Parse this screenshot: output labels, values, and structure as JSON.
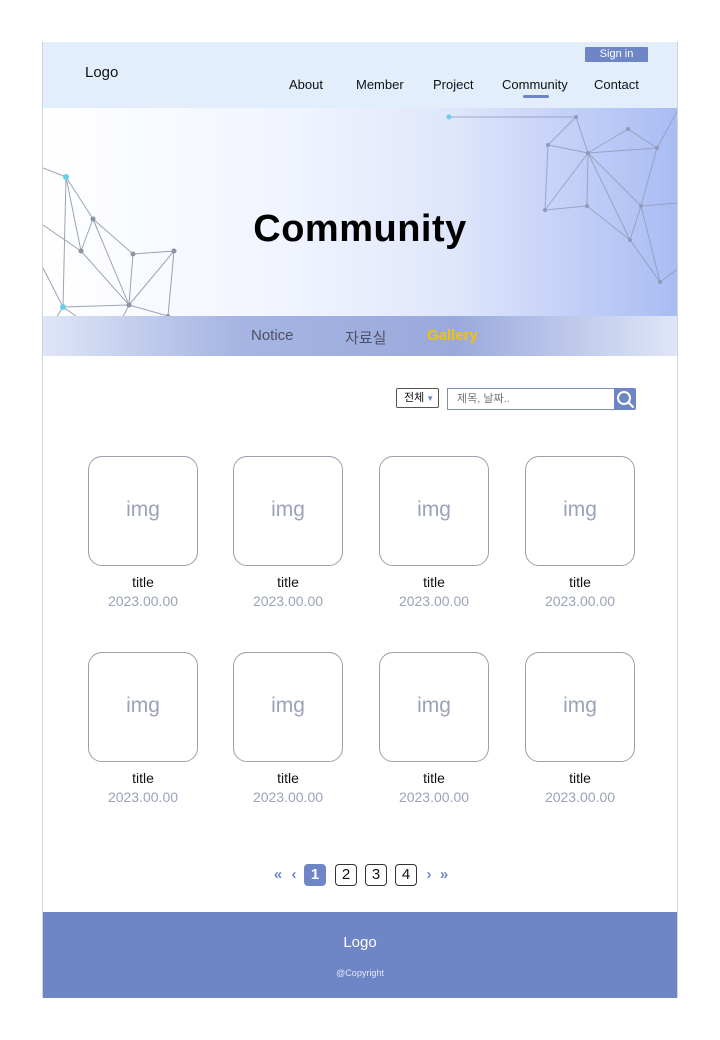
{
  "header": {
    "logo": "Logo",
    "sign_in": "Sign in",
    "nav": [
      "About",
      "Member",
      "Project",
      "Community",
      "Contact"
    ]
  },
  "hero": {
    "title": "Community"
  },
  "subtabs": {
    "notice": "Notice",
    "data": "자료실",
    "gallery": "Gallery"
  },
  "search": {
    "filter_value": "전체",
    "placeholder": "제목, 날짜..",
    "search_icon": "search-icon"
  },
  "gallery": [
    {
      "img": "img",
      "title": "title",
      "date": "2023.00.00"
    },
    {
      "img": "img",
      "title": "title",
      "date": "2023.00.00"
    },
    {
      "img": "img",
      "title": "title",
      "date": "2023.00.00"
    },
    {
      "img": "img",
      "title": "title",
      "date": "2023.00.00"
    },
    {
      "img": "img",
      "title": "title",
      "date": "2023.00.00"
    },
    {
      "img": "img",
      "title": "title",
      "date": "2023.00.00"
    },
    {
      "img": "img",
      "title": "title",
      "date": "2023.00.00"
    },
    {
      "img": "img",
      "title": "title",
      "date": "2023.00.00"
    }
  ],
  "pagination": {
    "first": "«",
    "prev": "‹",
    "pages": [
      "1",
      "2",
      "3",
      "4"
    ],
    "current": "1",
    "next": "›",
    "last": "»"
  },
  "footer": {
    "logo": "Logo",
    "copyright": "@Copyright"
  },
  "colors": {
    "accent": "#6f86c6",
    "header_bg": "#e3eefc",
    "active_tab": "#f5c200"
  }
}
